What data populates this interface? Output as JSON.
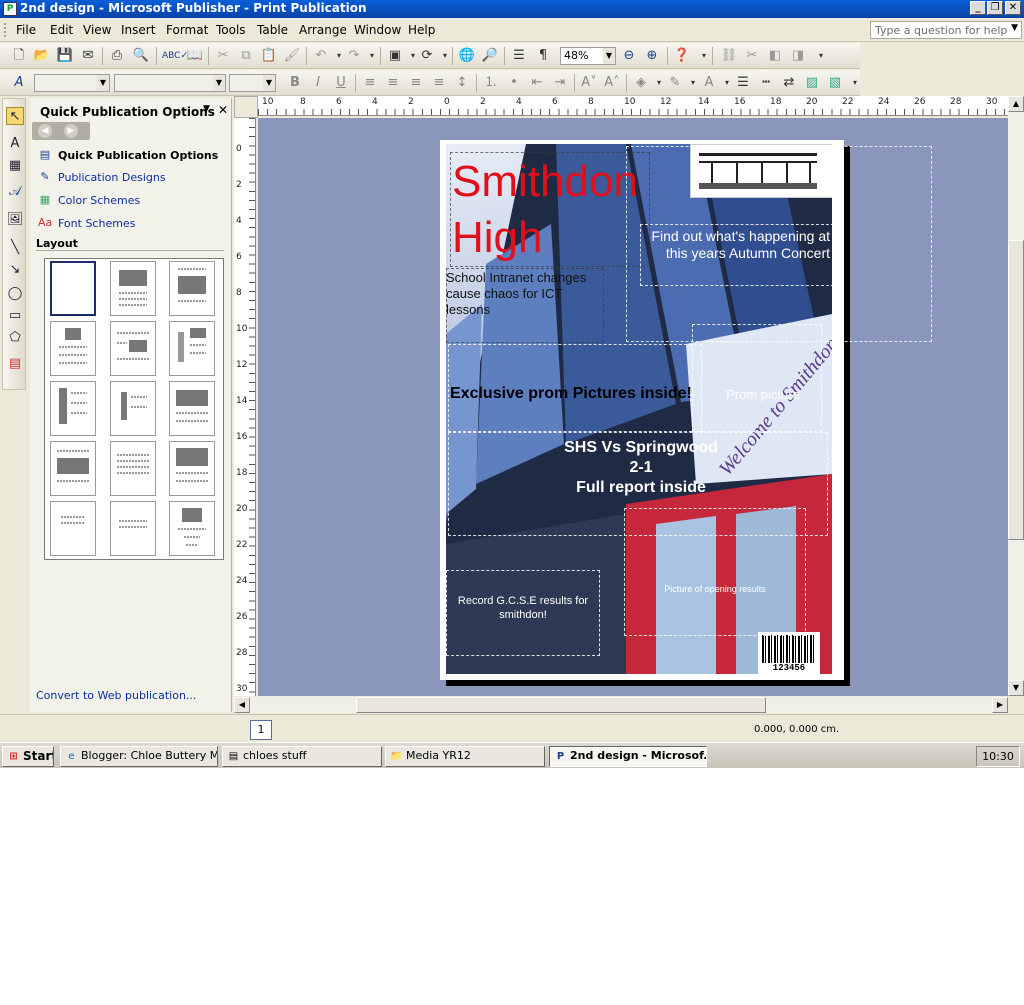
{
  "window": {
    "title": "2nd design - Microsoft Publisher - Print Publication",
    "minimize": "_",
    "restore": "❐",
    "close": "✕"
  },
  "menu": {
    "items": [
      "File",
      "Edit",
      "View",
      "Insert",
      "Format",
      "Tools",
      "Table",
      "Arrange",
      "Window",
      "Help"
    ],
    "ask_placeholder": "Type a question for help"
  },
  "toolbar": {
    "zoom": "48%"
  },
  "taskpane": {
    "title": "Quick Publication Options",
    "heading": "Quick Publication Options",
    "links": [
      "Publication Designs",
      "Color Schemes",
      "Font Schemes"
    ],
    "layout_label": "Layout",
    "convert_link": "Convert to Web publication..."
  },
  "ruler": {
    "top": [
      "10",
      "8",
      "6",
      "4",
      "2",
      "0",
      "2",
      "4",
      "6",
      "8",
      "10",
      "12",
      "14",
      "16",
      "18",
      "20",
      "22",
      "24",
      "26",
      "28",
      "30"
    ],
    "left": [
      "0",
      "2",
      "4",
      "6",
      "8",
      "10",
      "12",
      "14",
      "16",
      "18",
      "20",
      "22",
      "24",
      "26",
      "28",
      "30"
    ]
  },
  "publication": {
    "title_line1": "Smithdon",
    "title_line2": "High",
    "concert": "Find out what's happening at this years Autumn Concert",
    "intranet": "School Intranet changes cause chaos for ICT lessons",
    "prom": "Exclusive prom Pictures inside!",
    "prom_picture": "Prom picture",
    "match_line1": "SHS Vs Springwood",
    "match_line2": "2-1",
    "match_line3": "Full report inside",
    "gcse": "Record G.C.S.E results for smithdon!",
    "opening_picture": "Picture of opening results",
    "barcode_number": "123456",
    "building_sign": "Welcome to Smithdon High School"
  },
  "status": {
    "page_number": "1",
    "coordinates": "0.000, 0.000 cm."
  },
  "taskbar": {
    "start": "Start",
    "tasks": [
      "Blogger: Chloe Buttery M...",
      "chloes stuff",
      "Media YR12",
      "2nd design - Microsof..."
    ],
    "clock": "10:30"
  }
}
